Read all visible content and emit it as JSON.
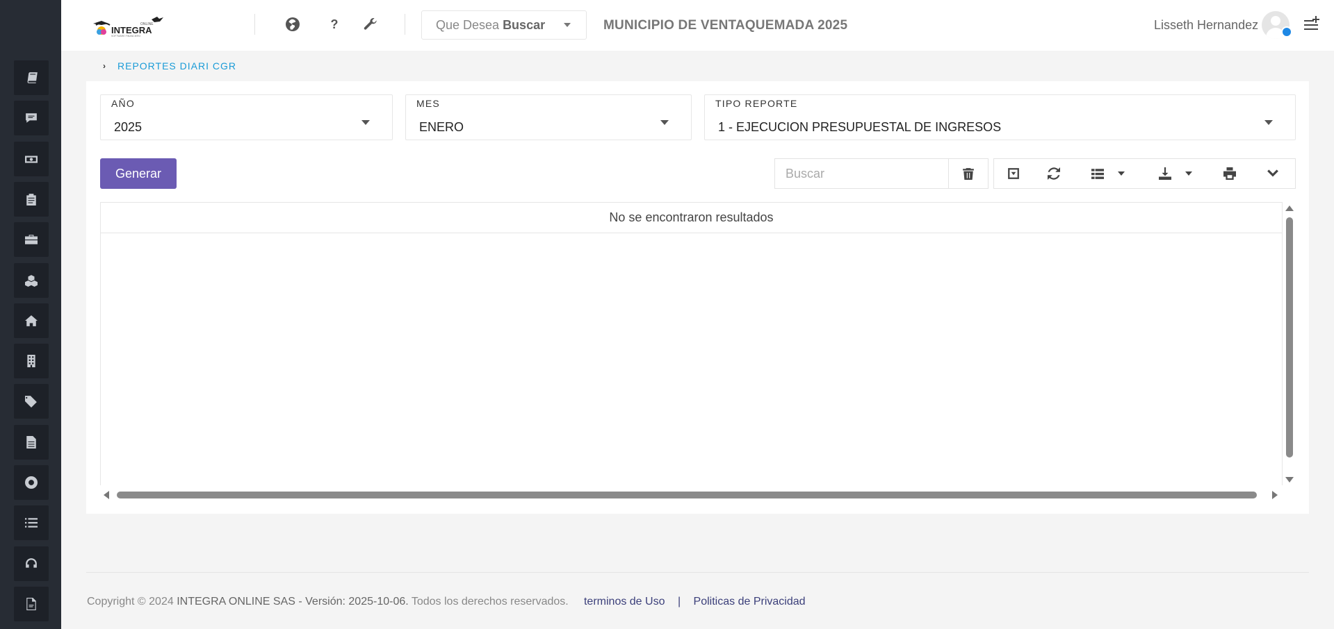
{
  "header": {
    "search_placeholder_prefix": "Que Desea",
    "search_placeholder_bold": "Buscar",
    "help_label": "?",
    "municipality": "MUNICIPIO DE VENTAQUEMADA 2025",
    "user_name": "Lisseth Hernandez"
  },
  "breadcrumb": {
    "current": "REPORTES DIARI CGR"
  },
  "filters": {
    "year_label": "AÑO",
    "year_value": "2025",
    "month_label": "MES",
    "month_value": "ENERO",
    "report_type_label": "TIPO REPORTE",
    "report_type_value": "1 - EJECUCION PRESUPUESTAL DE INGRESOS"
  },
  "toolbar": {
    "generate_label": "Generar",
    "search_placeholder": "Buscar"
  },
  "table": {
    "empty_message": "No se encontraron resultados"
  },
  "footer": {
    "copyright": "Copyright © 2024",
    "company": "INTEGRA ONLINE SAS - Versión: 2025-10-06.",
    "rights": "Todos los derechos reservados.",
    "terms_link": "terminos de Uso",
    "separator": "|",
    "privacy_link": "Politicas de Privacidad"
  },
  "colors": {
    "sidebar_bg": "#272c34",
    "accent_button": "#6b5bb3",
    "breadcrumb_link": "#1a9bd7",
    "status_dot": "#1e88e5"
  },
  "icons": {
    "sidebar": [
      "book-icon",
      "chat-icon",
      "money-icon",
      "clipboard-icon",
      "briefcase-icon",
      "cubes-icon",
      "home-icon",
      "building-icon",
      "tags-icon",
      "file-icon",
      "lifebuoy-icon",
      "list-icon",
      "headset-icon",
      "pdf-icon"
    ],
    "header": [
      "globe-icon",
      "question-icon",
      "wrench-icon",
      "menu-plus-icon"
    ],
    "toolbar": [
      "trash-icon",
      "collapse-icon",
      "refresh-icon",
      "columns-icon",
      "download-icon",
      "print-icon",
      "chevron-down-icon"
    ]
  }
}
